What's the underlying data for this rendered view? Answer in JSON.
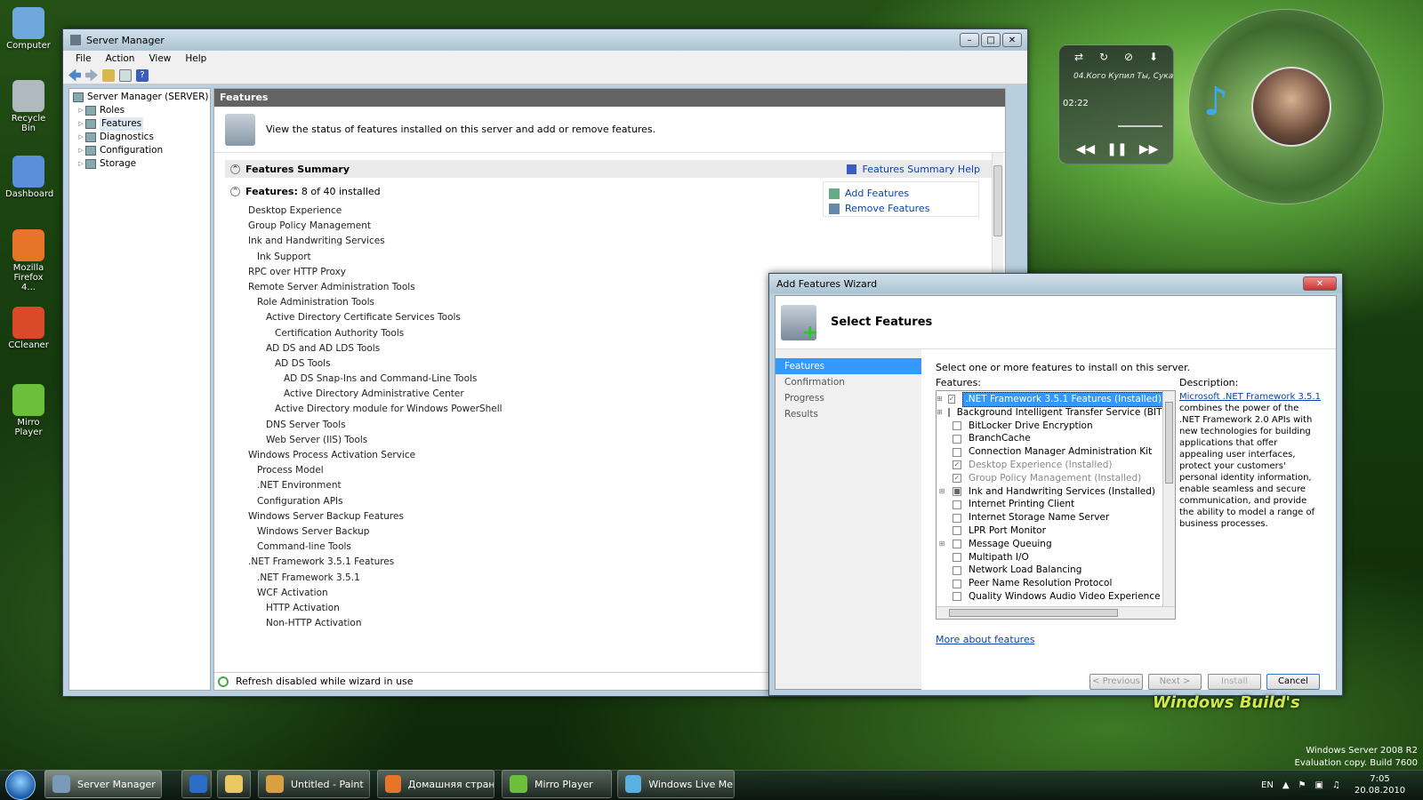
{
  "desktop": {
    "icons": [
      {
        "label": "Computer",
        "color": "#6fa8dc"
      },
      {
        "label": "Recycle Bin",
        "color": "#b0b8c0"
      },
      {
        "label": "Dashboard",
        "color": "#5b8fd8"
      },
      {
        "label": "Mozilla Firefox 4...",
        "color": "#e8742a"
      },
      {
        "label": "CCleaner",
        "color": "#d94a2a"
      },
      {
        "label": "Mirro Player",
        "color": "#6bbf3a"
      }
    ],
    "os_line1": "Windows Server 2008 R2",
    "os_line2": "Evaluation copy. Build 7600",
    "watermark": "Windows Build's"
  },
  "player": {
    "track": "04.Кого Купил Ты, Сука",
    "time": "02:22",
    "icons": [
      "shuffle-icon",
      "repeat-icon",
      "stop-icon",
      "download-icon",
      "rewind-icon",
      "pause-icon",
      "fast-forward-icon",
      "music-note-icon"
    ]
  },
  "server_manager": {
    "title": "Server Manager",
    "menu": [
      "File",
      "Action",
      "View",
      "Help"
    ],
    "tree": {
      "root": "Server Manager (SERVER)",
      "items": [
        "Roles",
        "Features",
        "Diagnostics",
        "Configuration",
        "Storage"
      ]
    },
    "header": "Features",
    "intro": "View the status of features installed on this server and add or remove features.",
    "summary_title": "Features Summary",
    "summary_help": "Features Summary Help",
    "features_label": "Features:",
    "features_count": "8 of 40 installed",
    "add_features": "Add Features",
    "remove_features": "Remove Features",
    "installed": [
      {
        "t": "Desktop Experience",
        "l": 0
      },
      {
        "t": "Group Policy Management",
        "l": 0
      },
      {
        "t": "Ink and Handwriting Services",
        "l": 0
      },
      {
        "t": "Ink Support",
        "l": 1
      },
      {
        "t": "RPC over HTTP Proxy",
        "l": 0
      },
      {
        "t": "Remote Server Administration Tools",
        "l": 0
      },
      {
        "t": "Role Administration Tools",
        "l": 1
      },
      {
        "t": "Active Directory Certificate Services Tools",
        "l": 2
      },
      {
        "t": "Certification Authority Tools",
        "l": 3
      },
      {
        "t": "AD DS and AD LDS Tools",
        "l": 2
      },
      {
        "t": "AD DS Tools",
        "l": 3
      },
      {
        "t": "AD DS Snap-Ins and Command-Line Tools",
        "l": 4
      },
      {
        "t": "Active Directory Administrative Center",
        "l": 4
      },
      {
        "t": "Active Directory module for Windows PowerShell",
        "l": 3
      },
      {
        "t": "DNS Server Tools",
        "l": 2
      },
      {
        "t": "Web Server (IIS) Tools",
        "l": 2
      },
      {
        "t": "Windows Process Activation Service",
        "l": 0
      },
      {
        "t": "Process Model",
        "l": 1
      },
      {
        "t": ".NET Environment",
        "l": 1
      },
      {
        "t": "Configuration APIs",
        "l": 1
      },
      {
        "t": "Windows Server Backup Features",
        "l": 0
      },
      {
        "t": "Windows Server Backup",
        "l": 1
      },
      {
        "t": "Command-line Tools",
        "l": 1
      },
      {
        "t": ".NET Framework 3.5.1 Features",
        "l": 0
      },
      {
        "t": ".NET Framework 3.5.1",
        "l": 1
      },
      {
        "t": "WCF Activation",
        "l": 1
      },
      {
        "t": "HTTP Activation",
        "l": 2
      },
      {
        "t": "Non-HTTP Activation",
        "l": 2
      }
    ],
    "status": "Refresh disabled while wizard in use"
  },
  "wizard": {
    "title": "Add Features Wizard",
    "heading": "Select Features",
    "steps": [
      "Features",
      "Confirmation",
      "Progress",
      "Results"
    ],
    "instruction": "Select one or more features to install on this server.",
    "features_label": "Features:",
    "description_label": "Description:",
    "desc_link": "Microsoft .NET Framework 3.5.1",
    "desc_text": "combines the power of the .NET Framework 2.0 APIs with new technologies for building applications that offer appealing user interfaces, protect your customers' personal identity information, enable seamless and secure communication, and provide the ability to model a range of business processes.",
    "features": [
      {
        "t": ".NET Framework 3.5.1 Features  (Installed)",
        "exp": true,
        "chk": "✓",
        "dis": true,
        "sel": true
      },
      {
        "t": "Background Intelligent Transfer Service (BITS)",
        "exp": true,
        "chk": "",
        "dis": false
      },
      {
        "t": "BitLocker Drive Encryption",
        "exp": false,
        "chk": "",
        "dis": false
      },
      {
        "t": "BranchCache",
        "exp": false,
        "chk": "",
        "dis": false
      },
      {
        "t": "Connection Manager Administration Kit",
        "exp": false,
        "chk": "",
        "dis": false
      },
      {
        "t": "Desktop Experience  (Installed)",
        "exp": false,
        "chk": "✓",
        "dis": true
      },
      {
        "t": "Group Policy Management  (Installed)",
        "exp": false,
        "chk": "✓",
        "dis": true
      },
      {
        "t": "Ink and Handwriting Services  (Installed)",
        "exp": true,
        "chk": "■",
        "dis": false
      },
      {
        "t": "Internet Printing Client",
        "exp": false,
        "chk": "",
        "dis": false
      },
      {
        "t": "Internet Storage Name Server",
        "exp": false,
        "chk": "",
        "dis": false
      },
      {
        "t": "LPR Port Monitor",
        "exp": false,
        "chk": "",
        "dis": false
      },
      {
        "t": "Message Queuing",
        "exp": true,
        "chk": "",
        "dis": false
      },
      {
        "t": "Multipath I/O",
        "exp": false,
        "chk": "",
        "dis": false
      },
      {
        "t": "Network Load Balancing",
        "exp": false,
        "chk": "",
        "dis": false
      },
      {
        "t": "Peer Name Resolution Protocol",
        "exp": false,
        "chk": "",
        "dis": false
      },
      {
        "t": "Quality Windows Audio Video Experience",
        "exp": false,
        "chk": "",
        "dis": false
      }
    ],
    "more_link": "More about features",
    "prev": "< Previous",
    "next": "Next >",
    "install": "Install",
    "cancel": "Cancel"
  },
  "taskbar": {
    "items": [
      {
        "label": "Server Manager",
        "color": "#7a9ab8"
      },
      {
        "label": "",
        "color": "#2a6cc8"
      },
      {
        "label": "",
        "color": "#e8c860"
      },
      {
        "label": "Untitled - Paint",
        "color": "#d8a040"
      },
      {
        "label": "Домашняя стран...",
        "color": "#e8742a"
      },
      {
        "label": "Mirro Player",
        "color": "#6bbf3a"
      },
      {
        "label": "Windows Live Me...",
        "color": "#5ab0e0"
      }
    ],
    "lang": "EN",
    "time": "7:05",
    "date": "20.08.2010"
  }
}
